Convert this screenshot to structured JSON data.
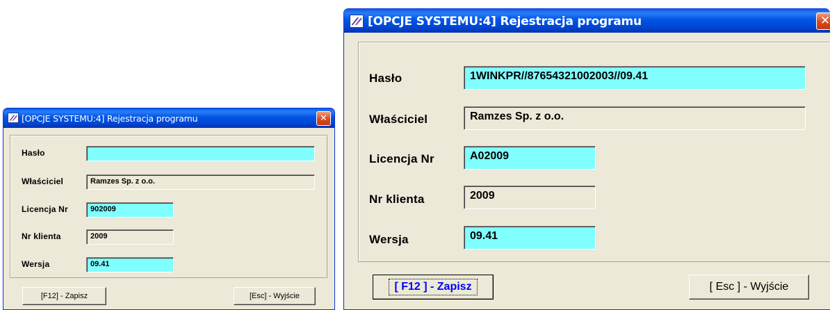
{
  "windows": {
    "small": {
      "title": "[OPCJE SYSTEMU:4]  Rejestracja programu",
      "close_icon": "close-icon",
      "labels": {
        "password": "Hasło",
        "owner": "Właściciel",
        "license": "Licencja Nr",
        "client": "Nr klienta",
        "version": "Wersja"
      },
      "values": {
        "password": "",
        "owner": "Ramzes Sp. z o.o.",
        "license": "902009",
        "client": "2009",
        "version": "09.41"
      },
      "buttons": {
        "save": "[F12] - Zapisz",
        "exit": "[Esc] - Wyjście"
      }
    },
    "large": {
      "title": "[OPCJE SYSTEMU:4]  Rejestracja programu",
      "close_icon": "close-icon",
      "labels": {
        "password": "Hasło",
        "owner": "Właściciel",
        "license": "Licencja Nr",
        "client": "Nr klienta",
        "version": "Wersja"
      },
      "values": {
        "password": "1WINKPR//87654321002003//09.41",
        "owner": "Ramzes Sp. z o.o.",
        "license": "A02009",
        "client": "2009",
        "version": "09.41"
      },
      "buttons": {
        "save": "[ F12 ] - Zapisz",
        "exit": "[ Esc ] - Wyjście"
      }
    }
  },
  "colors": {
    "editable_field": "#80ffff",
    "window_bg": "#ece9d8",
    "titlebar": "#0055e5",
    "close_button": "#d9481c",
    "default_button_text": "#0000ff"
  }
}
